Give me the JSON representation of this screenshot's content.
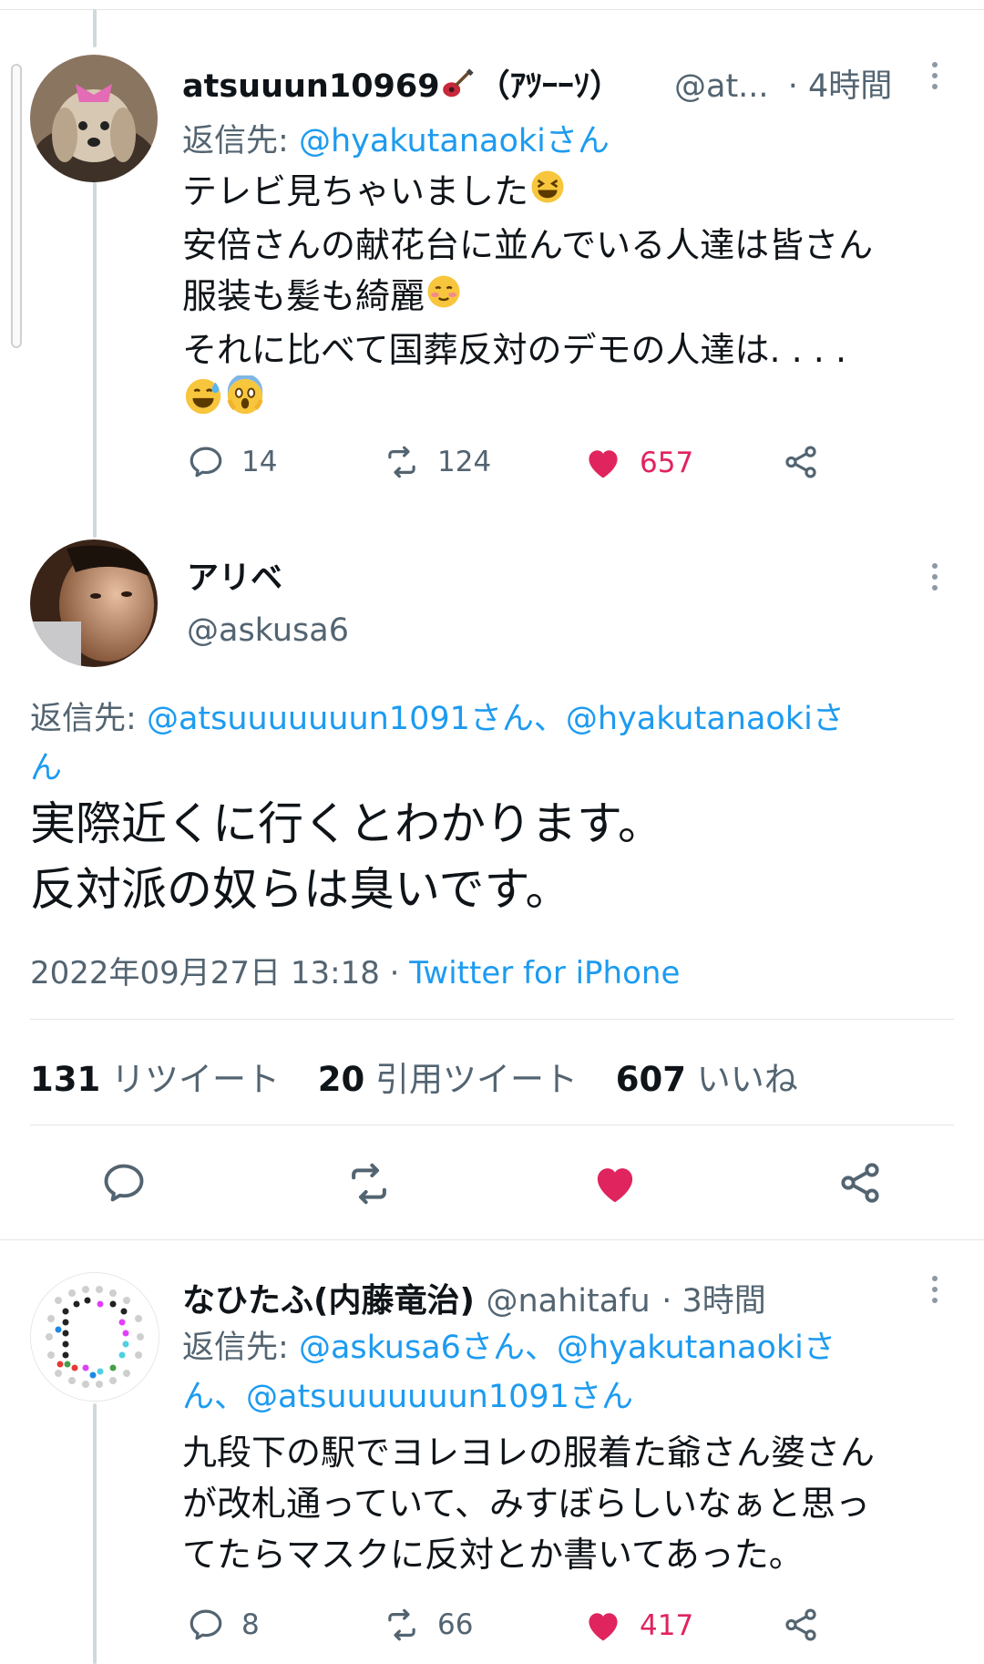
{
  "tweet1": {
    "display_name": "atsuuun10969",
    "name_suffix": "（ｱﾂｰｰｿ）",
    "handle": "@at...",
    "time": "· 4時間",
    "reply_prefix": "返信先:",
    "reply_to": "@hyakutanaokiさん",
    "lines": [
      "テレビ見ちゃいました",
      "安倍さんの献花台に並んでいる人達は皆さん",
      "服装も髪も綺麗",
      "それに比べて国葬反対のデモの人達は. . . ."
    ],
    "replies": "14",
    "retweets": "124",
    "likes": "657"
  },
  "main_tweet": {
    "display_name": "アリベ",
    "handle": "@askusa6",
    "reply_prefix": "返信先:",
    "reply_to_line1": "@atsuuuuuuun1091さん、@hyakutanaokiさ",
    "reply_to_line2": "ん",
    "lines": [
      "実際近くに行くとわかります。",
      "反対派の奴らは臭いです。"
    ],
    "timestamp": "2022年09月27日 13:18 · ",
    "source": "Twitter for iPhone",
    "retweet_count": "131",
    "retweet_label": "リツイート",
    "quote_count": "20",
    "quote_label": "引用ツイート",
    "like_count": "607",
    "like_label": "いいね"
  },
  "tweet3": {
    "display_name": "なひたふ(内藤竜治)",
    "handle": "@nahitafu",
    "time": "· 3時間",
    "reply_prefix": "返信先:",
    "reply_to_line1": "@askusa6さん、@hyakutanaokiさ",
    "reply_to_line2": "ん、@atsuuuuuuun1091さん",
    "lines": [
      "九段下の駅でヨレヨレの服着た爺さん婆さん",
      "が改札通っていて、みすぼらしいなぁと思っ",
      "てたらマスクに反対とか書いてあった。"
    ],
    "replies": "8",
    "retweets": "66",
    "likes": "417"
  },
  "colors": {
    "link": "#1d9bf0",
    "like": "#e0245e",
    "secondary": "#536471",
    "primary": "#0f1419"
  }
}
